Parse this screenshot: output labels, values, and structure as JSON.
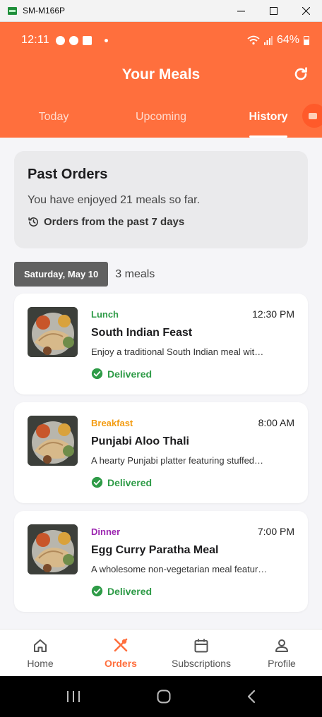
{
  "window": {
    "title": "SM-M166P"
  },
  "status_bar": {
    "time": "12:11",
    "battery": "64%"
  },
  "header": {
    "title": "Your Meals"
  },
  "tabs": [
    {
      "label": "Today",
      "active": false
    },
    {
      "label": "Upcoming",
      "active": false
    },
    {
      "label": "History",
      "active": true
    }
  ],
  "summary": {
    "title": "Past Orders",
    "count_text": "You have enjoyed 21 meals so far.",
    "range_text": "Orders from the past 7 days"
  },
  "date_group": {
    "date": "Saturday, May 10",
    "count": "3 meals"
  },
  "meals": [
    {
      "type": "Lunch",
      "type_color": "#2e9b47",
      "time": "12:30 PM",
      "name": "South Indian Feast",
      "desc": "Enjoy a traditional South Indian meal wit…",
      "status": "Delivered"
    },
    {
      "type": "Breakfast",
      "type_color": "#f39c12",
      "time": "8:00 AM",
      "name": "Punjabi Aloo Thali",
      "desc": "A hearty Punjabi platter featuring stuffed…",
      "status": "Delivered"
    },
    {
      "type": "Dinner",
      "type_color": "#9c27b0",
      "time": "7:00 PM",
      "name": "Egg Curry Paratha Meal",
      "desc": "A wholesome non-vegetarian meal featur…",
      "status": "Delivered"
    }
  ],
  "bottom_nav": [
    {
      "label": "Home",
      "icon": "home-icon",
      "active": false
    },
    {
      "label": "Orders",
      "icon": "fork-knife-icon",
      "active": true
    },
    {
      "label": "Subscriptions",
      "icon": "calendar-icon",
      "active": false
    },
    {
      "label": "Profile",
      "icon": "person-icon",
      "active": false
    }
  ],
  "colors": {
    "accent": "#ff6f3d",
    "delivered": "#2e9b47",
    "background": "#f5f5f8"
  }
}
